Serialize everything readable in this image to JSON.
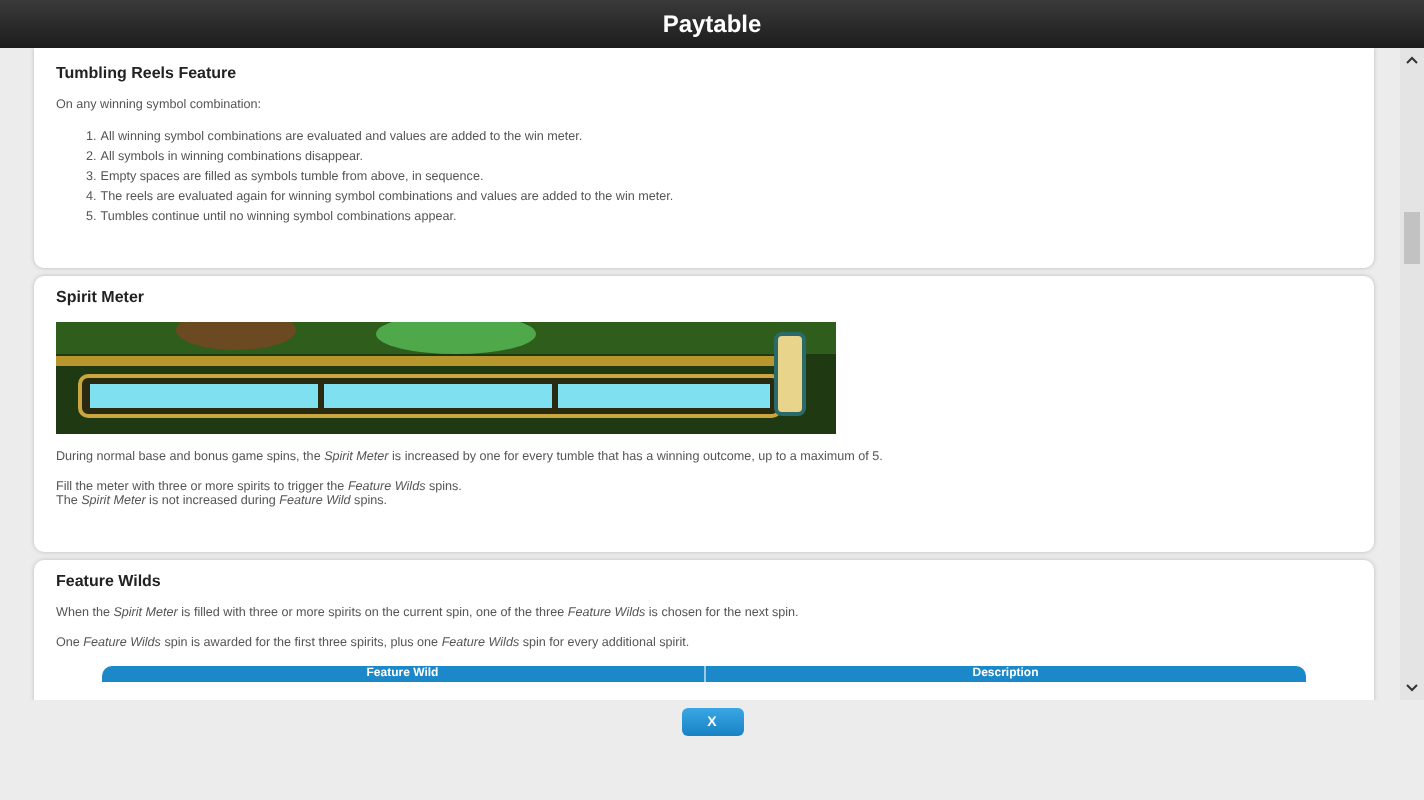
{
  "window": {
    "title": "Paytable"
  },
  "sections": [
    {
      "kind": "list",
      "title": "Tumbling Reels Feature",
      "intro": "On any winning symbol combination:",
      "steps": [
        {
          "number": "1.",
          "text": "All winning symbol combinations are evaluated and values are added to the win meter."
        },
        {
          "number": "2.",
          "text": "All symbols in winning combinations disappear."
        },
        {
          "number": "3.",
          "text": "Empty spaces are filled as symbols tumble from above, in sequence."
        },
        {
          "number": "4.",
          "text": "The reels are evaluated again for winning symbol combinations and values are added to the win meter."
        },
        {
          "number": "5.",
          "text": "Tumbles continue until no winning symbol combinations appear."
        }
      ]
    },
    {
      "kind": "meter",
      "title": "Spirit Meter",
      "paragraphs": [
        "During normal base and bonus game spins, the *Spirit Meter* is increased by one for every tumble that has a winning outcome, up to a maximum of 5.",
        "Fill the meter with three or more spirits to trigger the *Feature Wilds* spins.\nThe *Spirit Meter* is not increased during *Feature Wild* spins."
      ]
    },
    {
      "kind": "table",
      "title": "Feature Wilds",
      "paragraphs": [
        "When the *Spirit Meter* is filled with three or more spirits on the current spin, one of the three *Feature Wilds* is chosen for the next spin.",
        "One *Feature Wilds* spin is awarded for the first three spirits, plus one *Feature Wilds* spin for every additional spirit."
      ],
      "columns": [
        "Feature Wild",
        "Description"
      ]
    }
  ],
  "close_button": "X"
}
